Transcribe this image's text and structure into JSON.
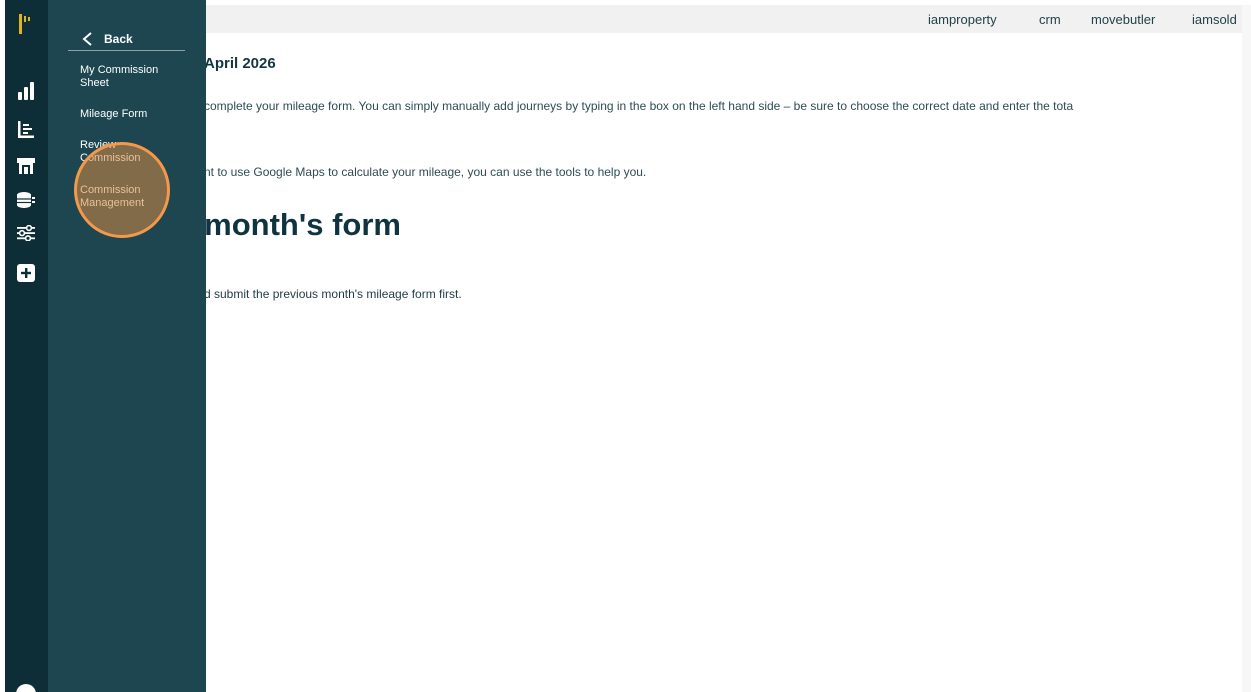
{
  "sidebar": {
    "back_label": "Back",
    "items": [
      {
        "label_line1": "My Commission",
        "label_line2": "Sheet"
      },
      {
        "label_line1": "Mileage Form",
        "label_line2": ""
      },
      {
        "label_line1": "Review",
        "label_line2": "Commission"
      },
      {
        "label_line1": "Commission",
        "label_line2": "Management"
      }
    ]
  },
  "rail": {
    "icons": [
      "logo-icon",
      "bar-chart-icon",
      "list-chart-icon",
      "storefront-icon",
      "coins-icon",
      "sliders-icon",
      "plus-square-icon"
    ]
  },
  "topbar": {
    "links": [
      "iamproperty",
      "crm",
      "movebutler",
      "iamsold"
    ]
  },
  "main": {
    "month_title": "April 2026",
    "intro": "complete your mileage form. You can simply manually add journeys by typing in the box on the left hand side – be sure to choose the correct date and enter the tota",
    "intro2": "nt to use Google Maps to calculate your mileage, you can use the tools to help you.",
    "heading": "st month's form",
    "note": "d submit the previous month's mileage form first."
  },
  "colors": {
    "rail_bg": "#0d2e36",
    "subnav_bg": "#1d4650",
    "highlight": "#f4994a",
    "logo_accent": "#e2b321"
  }
}
